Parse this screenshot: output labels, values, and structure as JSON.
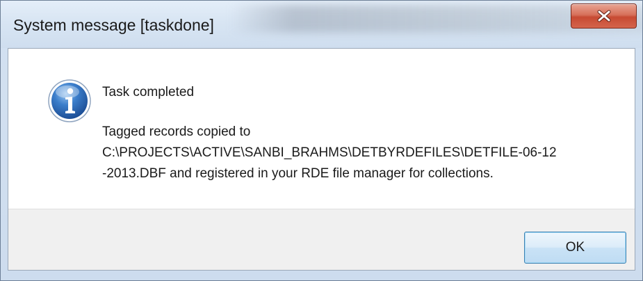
{
  "window": {
    "title": "System message [taskdone]"
  },
  "titlebar": {
    "close_icon": "close-x-icon"
  },
  "message": {
    "icon": "info-icon",
    "heading": "Task completed",
    "body_lines": [
      "Tagged records copied to",
      "C:\\PROJECTS\\ACTIVE\\SANBI_BRAHMS\\DETBYRDEFILES\\DETFILE-06-12",
      "-2013.DBF and registered in your RDE file manager for collections."
    ]
  },
  "buttons": {
    "ok_label": "OK"
  },
  "colors": {
    "close_button": "#c74a32",
    "ok_border": "#3c7fb1",
    "info_icon": "#2f6bb5"
  }
}
